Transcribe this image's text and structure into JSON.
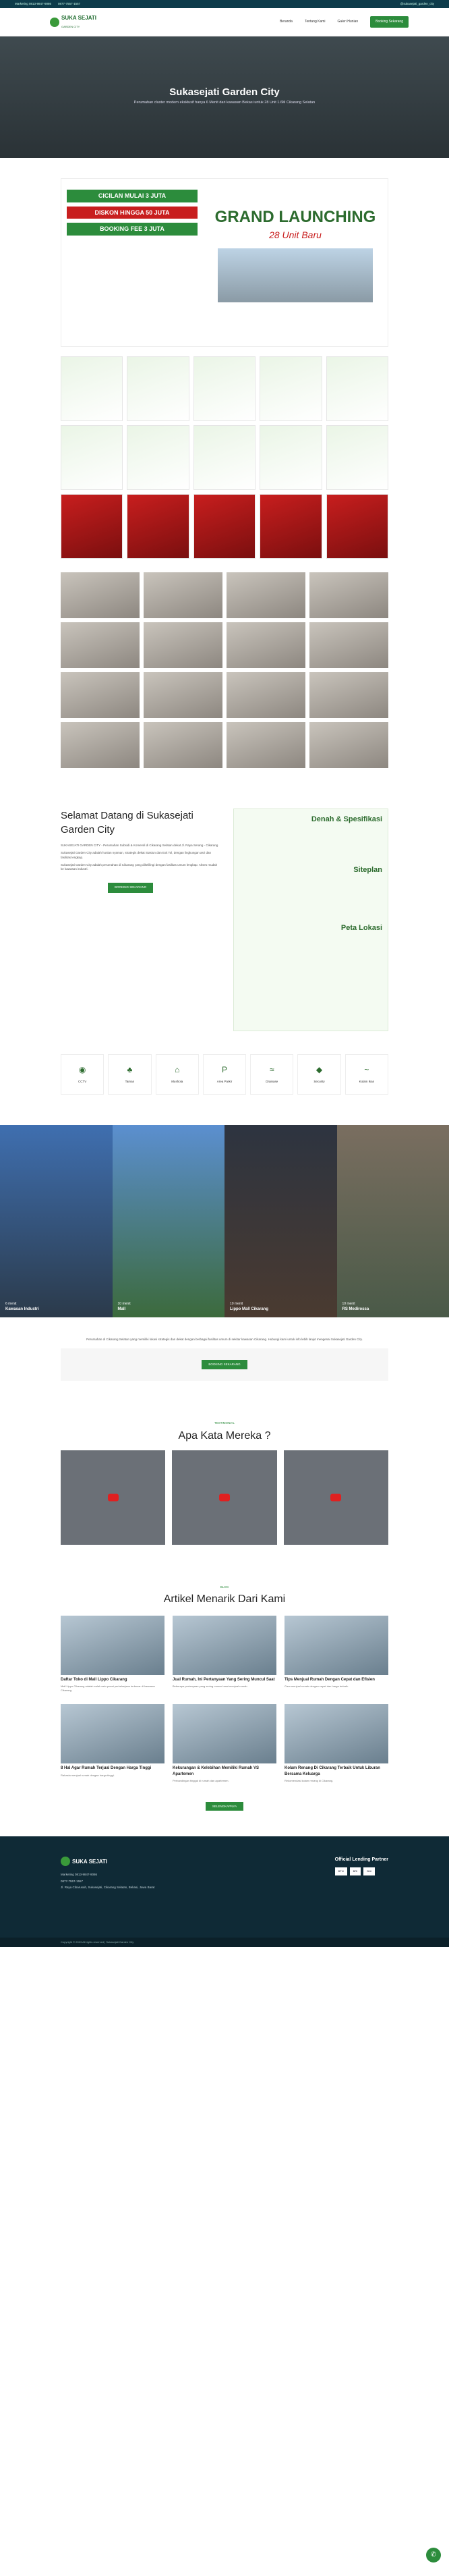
{
  "topbar": {
    "items": [
      "Marketing 0813-9847-9086",
      "0877-7557-1557",
      "@sukasejati_garden_city"
    ]
  },
  "nav": {
    "brand": "SUKA SEJATI",
    "brand_sub": "GARDEN CITY",
    "menu": [
      "Beranda",
      "Tentang Kami",
      "Galeri Hunian"
    ],
    "cta": "Booking Sekarang"
  },
  "hero": {
    "title": "Sukasejati Garden City",
    "subtitle": "Perumahan cluster modern eksklusif hanya 6 Menit dari kawasan Bekasi untuk 28 Unit 1.6M Cikarang Selatan"
  },
  "banner": {
    "badges": [
      "CICILAN MULAI 3 JUTA",
      "DISKON HINGGA 50 JUTA",
      "BOOKING FEE 3 JUTA"
    ],
    "title": "GRAND LAUNCHING",
    "subtitle": "28 Unit Baru"
  },
  "welcome": {
    "title": "Selamat Datang di Sukasejati Garden City",
    "paragraphs": [
      "SUKASEJATI GARDEN CITY - Perumahan Subsidi & Komersil di Cikarang Selatan dekat Jl. Raya Serang - Cikarang",
      "Sukasejati Garden City adalah hunian nyaman, strategis dekat Stasiun dan Exit Tol, dengan lingkungan asri dan fasilitas lengkap.",
      "Sukasejati Garden City adalah perumahan di Cikarang yang dikelilingi dengan fasilitas umum lengkap. Akses mudah ke kawasan industri."
    ],
    "cta": "BOOKING SEKARANG",
    "spec_titles": [
      "Denah & Spesifikasi",
      "Siteplan",
      "Peta Lokasi"
    ]
  },
  "facilities": [
    "CCTV",
    "Taman",
    "Mushola",
    "Area Parkir",
    "Drainase",
    "Security",
    "Kolam Ikan"
  ],
  "places": [
    {
      "time": "6 menit",
      "name": "Kawasan Industri"
    },
    {
      "time": "10 menit",
      "name": "Mall"
    },
    {
      "time": "10 menit",
      "name": "Lippo Mall Cikarang"
    },
    {
      "time": "10 menit",
      "name": "RS Medirossa"
    }
  ],
  "location": {
    "text": "Perumahan di Cikarang Selatan yang memiliki lokasi strategis dan dekat dengan berbagai fasilitas umum di sekitar kawasan Cikarang. Hubungi kami untuk info lebih lanjut mengenai Sukasejati Garden City.",
    "cta": "BOOKING SEKARANG"
  },
  "testimonial": {
    "pre": "TESTIMONIAL",
    "title": "Apa Kata Mereka ?"
  },
  "articles": {
    "pre": "BLOG",
    "title": "Artikel Menarik Dari Kami",
    "items": [
      {
        "title": "Daftar Toko di Mall Lippo Cikarang",
        "desc": "Mall Lippo Cikarang adalah salah satu pusat perbelanjaan terbesar di kawasan Cikarang."
      },
      {
        "title": "Jual Rumah, Ini Pertanyaan Yang Sering Muncul Saat",
        "desc": "Beberapa pertanyaan yang sering muncul saat menjual rumah."
      },
      {
        "title": "Tips Menjual Rumah Dengan Cepat dan Efisien",
        "desc": "Cara menjual rumah dengan cepat dan harga terbaik."
      },
      {
        "title": "8 Hal Agar Rumah Terjual Dengan Harga Tinggi",
        "desc": "Rahasia menjual rumah dengan harga tinggi."
      },
      {
        "title": "Kekurangan & Kelebihan Memiliki Rumah VS Apartemen",
        "desc": "Perbandingan tinggal di rumah dan apartemen."
      },
      {
        "title": "Kolam Renang Di Cikarang Terbaik Untuk Liburan Bersama Keluarga",
        "desc": "Rekomendasi kolam renang di Cikarang."
      }
    ]
  },
  "more": "SELENGKAPNYA",
  "footer": {
    "lines": [
      "Marketing 0813-9847-9086",
      "0877-7557-1557",
      "Jl. Raya Cibarusah, Sukasejati, Cikarang Selatan, Bekasi, Jawa Barat"
    ],
    "partners_title": "Official Lending Partner",
    "partners": [
      "BTN",
      "BRI",
      "BNI"
    ]
  },
  "copyright": "Copyright © 2023 All rights reserved | Sukasejati Garden City"
}
